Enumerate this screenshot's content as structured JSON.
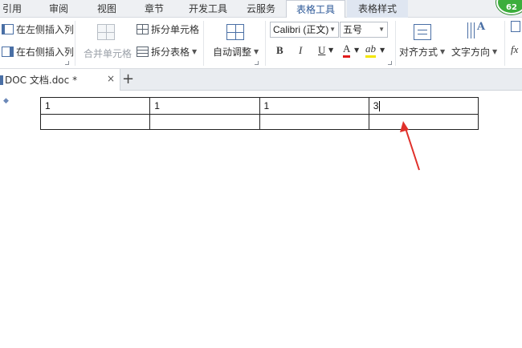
{
  "menu": {
    "tabs": [
      "引用",
      "审阅",
      "视图",
      "章节",
      "开发工具",
      "云服务",
      "表格工具",
      "表格样式"
    ],
    "active_tab": "表格工具",
    "badge": "62"
  },
  "ribbon": {
    "insert_left_col": "在左侧插入列",
    "insert_right_col": "在右侧插入列",
    "merge_cells": "合并单元格",
    "split_cells": "拆分单元格",
    "split_table": "拆分表格",
    "auto_fit": "自动调整",
    "font_name": "Calibri (正文)",
    "font_size": "五号",
    "bold": "B",
    "italic": "I",
    "underline": "U",
    "font_color": "A",
    "highlight": "ab",
    "align": "对齐方式",
    "text_direction": "文字方向",
    "formula": "fx",
    "colors": {
      "font_color": "#e01b1b",
      "highlight": "#f3e600"
    }
  },
  "document_tab": {
    "label": "DOC 文档.doc *",
    "close": "×",
    "new": "+"
  },
  "table": {
    "rows": [
      [
        "1",
        "1",
        "1",
        "3"
      ],
      [
        "",
        "",
        "",
        ""
      ]
    ]
  },
  "annotation": {
    "color": "#e0302a"
  }
}
